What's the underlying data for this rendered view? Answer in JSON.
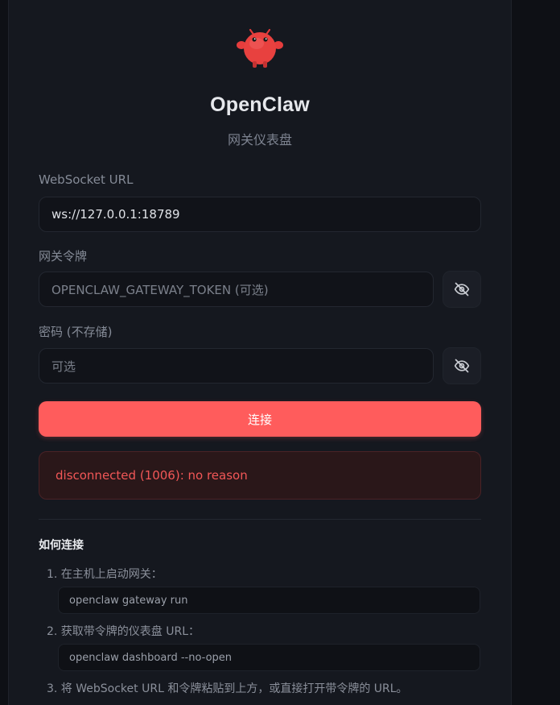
{
  "app": {
    "title": "OpenClaw",
    "subtitle": "网关仪表盘",
    "logo_icon": "red-claw-mascot-icon",
    "accent_color": "#ff5c5c"
  },
  "form": {
    "websocket": {
      "label": "WebSocket URL",
      "value": "ws://127.0.0.1:18789"
    },
    "token": {
      "label": "网关令牌",
      "placeholder": "OPENCLAW_GATEWAY_TOKEN (可选)",
      "toggle_icon": "eye-off-icon"
    },
    "password": {
      "label": "密码 (不存储)",
      "placeholder": "可选",
      "toggle_icon": "eye-off-icon"
    },
    "connect_label": "连接"
  },
  "status": {
    "error_text": "disconnected (1006): no reason",
    "error_color": "#f25757"
  },
  "howto": {
    "title": "如何连接",
    "steps": [
      {
        "text": "1. 在主机上启动网关：",
        "code": "openclaw gateway run"
      },
      {
        "text": "2. 获取带令牌的仪表盘 URL：",
        "code": "openclaw dashboard --no-open"
      },
      {
        "text": "3. 将 WebSocket URL 和令牌粘贴到上方，或直接打开带令牌的 URL。"
      }
    ]
  }
}
